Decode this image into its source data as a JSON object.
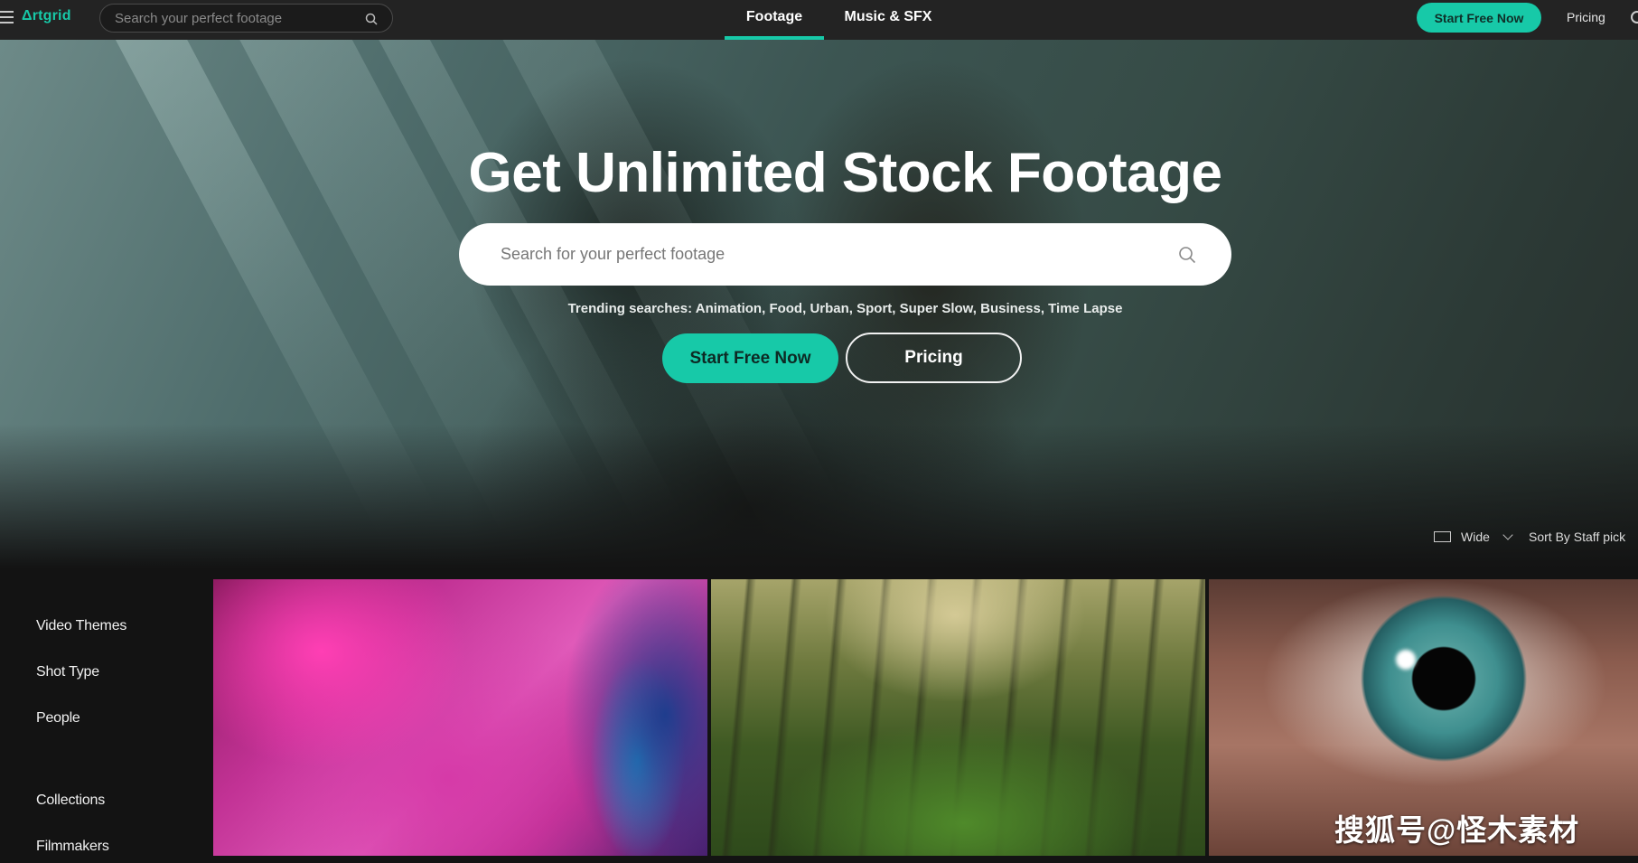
{
  "topbar": {
    "logo": "Δrtgrid",
    "search_placeholder": "Search your perfect footage",
    "tabs": [
      {
        "label": "Footage",
        "active": true
      },
      {
        "label": "Music & SFX",
        "active": false
      }
    ],
    "start_label": "Start Free Now",
    "pricing_label": "Pricing"
  },
  "hero": {
    "title": "Get Unlimited Stock Footage",
    "search_placeholder": "Search for your perfect footage",
    "trending_prefix": "Trending searches:",
    "trending": [
      "Animation",
      "Food",
      "Urban",
      "Sport",
      "Super Slow",
      "Business",
      "Time Lapse"
    ],
    "start_label": "Start Free Now",
    "pricing_label": "Pricing",
    "view_label": "Wide",
    "sort_label": "Sort By Staff pick"
  },
  "sidebar": {
    "items": [
      "Video Themes",
      "Shot Type",
      "People",
      "Collections",
      "Filmmakers"
    ]
  },
  "watermark": "搜狐号@怪木素材",
  "colors": {
    "accent": "#17c9a8",
    "topbar_bg": "#232323",
    "page_bg": "#131313"
  }
}
